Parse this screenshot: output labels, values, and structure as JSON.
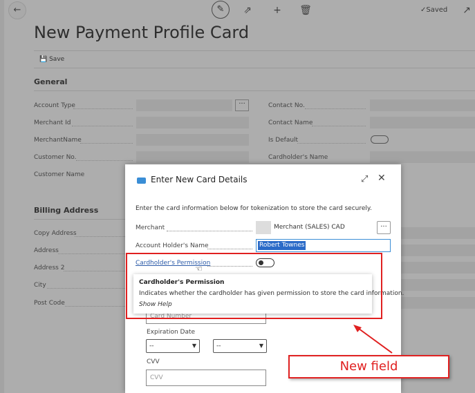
{
  "app": {
    "title": "New Payment Profile Card",
    "saved_label": "Saved",
    "save_label": "Save"
  },
  "general": {
    "heading": "General",
    "left_fields": [
      "Account Type",
      "Merchant Id",
      "MerchantName",
      "Customer No.",
      "Customer Name"
    ],
    "right_fields": [
      "Contact No.",
      "Contact Name",
      "Is Default",
      "Cardholder's Name"
    ]
  },
  "billing": {
    "heading": "Billing Address",
    "fields": [
      "Copy Address",
      "Address",
      "Address 2",
      "City",
      "Post Code"
    ]
  },
  "dialog": {
    "title": "Enter New Card Details",
    "description": "Enter the card information below for tokenization to store the card securely.",
    "merchant_label": "Merchant",
    "merchant_value": "Merchant (SALES) CAD",
    "account_holder_label": "Account Holder's Name",
    "account_holder_value": "Robert Townes",
    "permission_label": "Cardholder's Permission",
    "card_number_placeholder": "Card Number",
    "expiration_label": "Expiration Date",
    "month_value": "--",
    "year_value": "--",
    "cvv_label": "CVV",
    "cvv_placeholder": "CVV"
  },
  "tooltip": {
    "title": "Cardholder's Permission",
    "text": "Indicates whether the cardholder has given permission to store the card information.",
    "help": "Show Help"
  },
  "annotation": {
    "label": "New field",
    "color": "#e02020"
  },
  "colors": {
    "accent": "#3a8ed6",
    "link": "#2b5aa8"
  }
}
